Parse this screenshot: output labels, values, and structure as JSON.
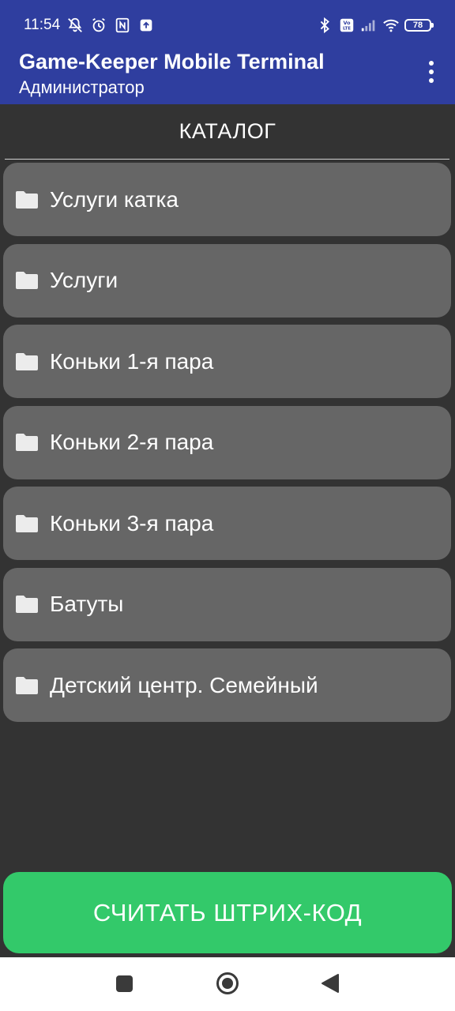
{
  "status_bar": {
    "time": "11:54",
    "left_icons": [
      "mute-icon",
      "alarm-icon",
      "nfc-icon",
      "upload-icon"
    ],
    "right_icons": [
      "bluetooth-icon",
      "volte-icon",
      "signal-icon",
      "wifi-icon"
    ],
    "battery_level": "78"
  },
  "app_bar": {
    "title": "Game-Keeper Mobile Terminal",
    "subtitle": "Администратор",
    "overflow_icon": "more-vert-icon"
  },
  "catalog": {
    "title": "КАТАЛОГ",
    "item_icon": "folder-icon",
    "items": [
      {
        "label": "Услуги катка"
      },
      {
        "label": "Услуги"
      },
      {
        "label": "Коньки 1-я пара"
      },
      {
        "label": "Коньки 2-я пара"
      },
      {
        "label": "Коньки 3-я пара"
      },
      {
        "label": "Батуты"
      },
      {
        "label": "Детский центр. Семейный"
      }
    ]
  },
  "actions": {
    "scan_label": "СЧИТАТЬ ШТРИХ-КОД"
  },
  "colors": {
    "app_bar": "#2f3e9f",
    "background": "#333333",
    "item_background": "#666666",
    "scan_button": "#33c96a"
  },
  "nav_bar": {
    "icons": [
      "recents-icon",
      "home-icon",
      "back-icon"
    ]
  }
}
